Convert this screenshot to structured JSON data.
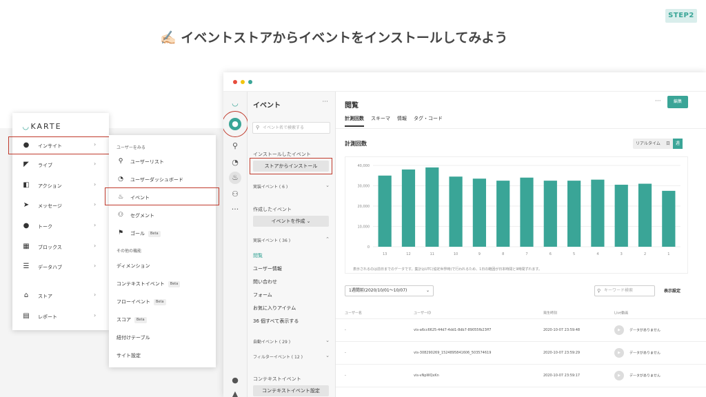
{
  "slide": {
    "title": "✍🏻 イベントストアからイベントをインストールしてみよう",
    "step": "STEP2"
  },
  "colors": {
    "accent": "#3aa597",
    "highlight": "#c0392b",
    "dot_red": "#e74c3c",
    "dot_yellow": "#f1c40f",
    "dot_teal": "#3aa597"
  },
  "menu": {
    "logo": "KARTE",
    "items": [
      {
        "label": "インサイト",
        "icon": "user-icon"
      },
      {
        "label": "ライブ",
        "icon": "live-icon"
      },
      {
        "label": "アクション",
        "icon": "action-icon"
      },
      {
        "label": "メッセージ",
        "icon": "send-icon"
      },
      {
        "label": "トーク",
        "icon": "talk-icon"
      },
      {
        "label": "ブロックス",
        "icon": "blocks-icon"
      },
      {
        "label": "データハブ",
        "icon": "database-icon"
      },
      {
        "label": "ストア",
        "icon": "store-icon"
      },
      {
        "label": "レポート",
        "icon": "report-icon"
      }
    ],
    "chevron": "›"
  },
  "submenu": {
    "section1": "ユーザーをみる",
    "items1": [
      {
        "label": "ユーザーリスト",
        "icon": "user-search-icon"
      },
      {
        "label": "ユーザーダッシュボード",
        "icon": "dashboard-icon"
      },
      {
        "label": "イベント",
        "icon": "fire-icon"
      },
      {
        "label": "セグメント",
        "icon": "users-icon"
      },
      {
        "label": "ゴール",
        "icon": "flag-icon",
        "badge": "Beta"
      }
    ],
    "section2": "その他の機能",
    "items2": [
      {
        "label": "ディメンション"
      },
      {
        "label": "コンテキストイベント",
        "badge": "Beta"
      },
      {
        "label": "フローイベント",
        "badge": "Beta"
      },
      {
        "label": "スコア",
        "badge": "Beta"
      },
      {
        "label": "紐付けテーブル"
      },
      {
        "label": "サイト設定"
      }
    ]
  },
  "panel": {
    "title": "イベント",
    "more": "···",
    "search_placeholder": "イベント名で検索する",
    "installed_label": "インストールしたイベント",
    "install_button": "ストアからインストール",
    "installed_count_label": "実装イベント ( 6 )",
    "created_label": "作成したイベント",
    "create_button": "イベントを作成 ⌄",
    "impl_label": "実装イベント ( 36 )",
    "impl_items": [
      "閲覧",
      "ユーザー情報",
      "問い合わせ",
      "フォーム",
      "お気に入りアイテム",
      "36 個すべて表示する"
    ],
    "auto_label": "自動イベント ( 29 )",
    "filter_label": "フィルターイベント ( 12 )",
    "context_label": "コンテキストイベント",
    "context_button": "コンテキストイベント設定"
  },
  "main": {
    "title": "閲覧",
    "more": "···",
    "edit_button": "編集",
    "tabs": [
      "計測回数",
      "スキーマ",
      "情報",
      "タグ・コード"
    ],
    "chart_title": "計測回数",
    "range": [
      "リアルタイム",
      "日",
      "週"
    ],
    "chart_note": "表示されるのは前日までのデータです。集計はUTC(協定世界時)で行われるため、1日の範囲が日本時間と9時間ずれます。",
    "period_select": "1週間前(2020/10/01〜10/07)",
    "keyword_placeholder": "キーワード検索",
    "display_settings": "表示設定",
    "table": {
      "headers": [
        "ユーザー名",
        "ユーザーID",
        "発生時刻",
        "Live動画"
      ],
      "rows": [
        {
          "name": "-",
          "id": "vis-a6cc6625-44d7-4dd1-8db7-89055fb23ff7",
          "time": "2020-10-07 23:59:48",
          "live": "データがありません"
        },
        {
          "name": "-",
          "id": "vis-308290269_1524895841606_503574619",
          "time": "2020-10-07 23:59:29",
          "live": "データがありません"
        },
        {
          "name": "-",
          "id": "vis-vNpWQxKn",
          "time": "2020-10-07 23:59:17",
          "live": "データがありません"
        }
      ]
    }
  },
  "chart_data": {
    "type": "bar",
    "categories": [
      "13",
      "12",
      "11",
      "10",
      "9",
      "8",
      "7",
      "6",
      "5",
      "4",
      "3",
      "2",
      "1"
    ],
    "values": [
      35000,
      38000,
      39000,
      34500,
      33500,
      32500,
      34000,
      32500,
      32500,
      33000,
      30500,
      31000,
      27500
    ],
    "y_ticks": [
      "0",
      "10,000",
      "20,000",
      "30,000",
      "40,000"
    ],
    "ylim": [
      0,
      40000
    ],
    "color": "#3aa597",
    "grid": true
  }
}
